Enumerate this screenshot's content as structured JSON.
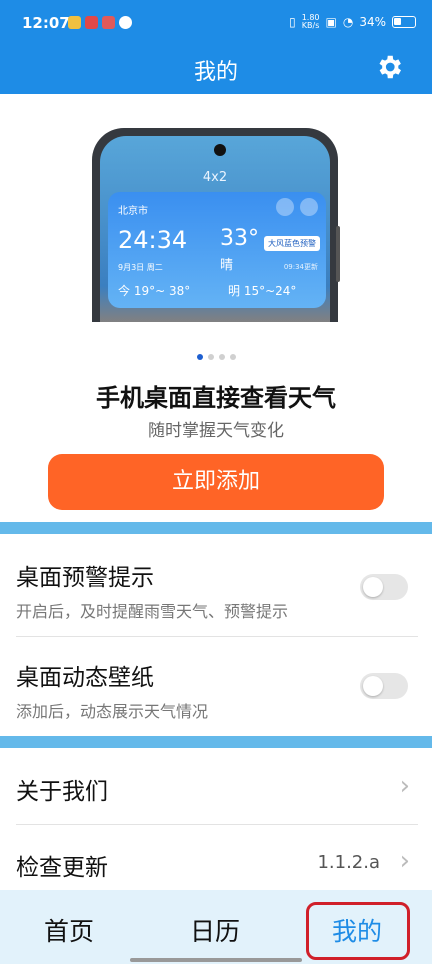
{
  "status_bar": {
    "time": "12:07",
    "net_speed": "1.80",
    "net_unit": "KB/s",
    "battery": "34%"
  },
  "header": {
    "title": "我的"
  },
  "banner": {
    "widget_size": "4x2",
    "city": "北京市",
    "time": "24:34",
    "date": "9月3日  周二",
    "temp": "33°",
    "condition": "晴",
    "alert": "大风蓝色预警",
    "updated": "09:34更新",
    "today": "今 19°~ 38°",
    "tomorrow": "明 15°~24°"
  },
  "promo": {
    "headline": "手机桌面直接查看天气",
    "subline": "随时掌握天气变化",
    "add_button": "立即添加"
  },
  "settings": [
    {
      "title": "桌面预警提示",
      "desc": "开启后，及时提醒雨雪天气、预警提示"
    },
    {
      "title": "桌面动态壁纸",
      "desc": "添加后，动态展示天气情况"
    }
  ],
  "list": {
    "about": "关于我们",
    "check_update": "检查更新",
    "version": "1.1.2.a"
  },
  "tabs": {
    "home": "首页",
    "calendar": "日历",
    "mine": "我的"
  },
  "colors": {
    "primary": "#1E8CE6",
    "accent_button": "#FF6426",
    "band": "#64B9EA",
    "highlight_box": "#D0202A"
  }
}
